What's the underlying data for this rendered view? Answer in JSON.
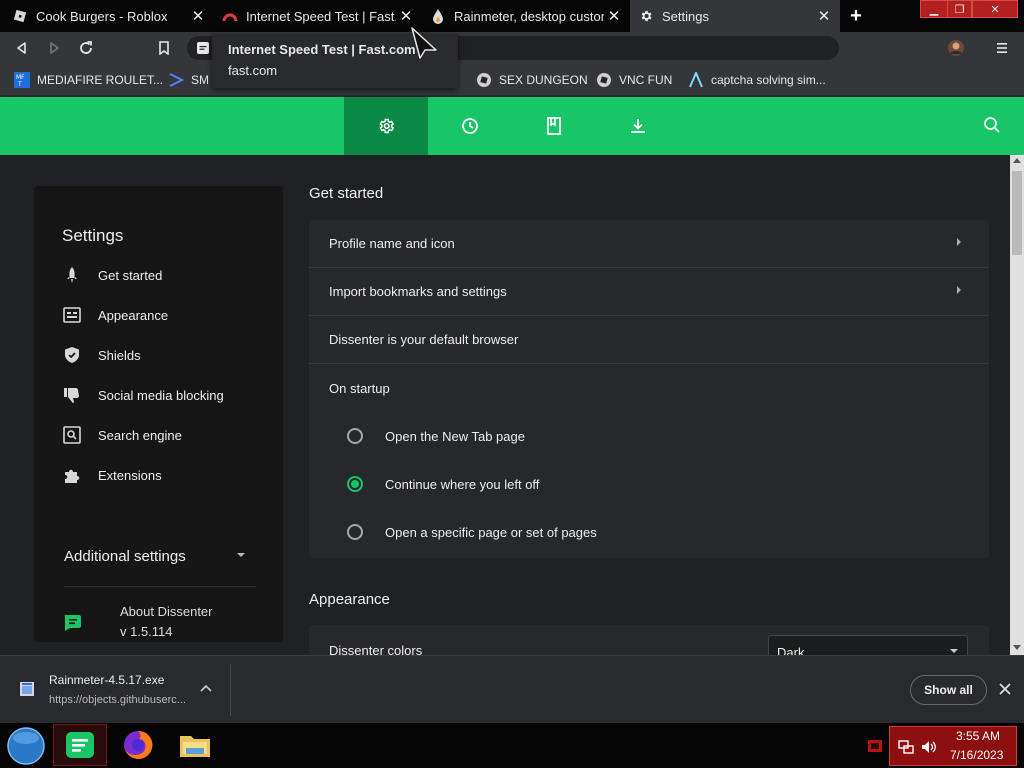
{
  "tabs": [
    {
      "title": "Cook Burgers - Roblox",
      "favicon": "roblox-icon"
    },
    {
      "title": "Internet Speed Test | Fast.com",
      "favicon": "fast-icon"
    },
    {
      "title": "Rainmeter, desktop customiz",
      "favicon": "rainmeter-icon"
    },
    {
      "title": "Settings",
      "favicon": "gear-icon",
      "active": true
    }
  ],
  "tooltip": {
    "title": "Internet Speed Test | Fast.com",
    "url": "fast.com"
  },
  "bookmarks": [
    {
      "label": "MEDIAFIRE ROULET...",
      "icon": "mediafire-icon"
    },
    {
      "label": "SM",
      "icon": "sm-icon"
    },
    {
      "label": "SEX DUNGEON",
      "icon": "roblox-bookmark-icon"
    },
    {
      "label": "VNC FUN",
      "icon": "roblox-bookmark-icon"
    },
    {
      "label": "captcha solving sim...",
      "icon": "captcha-icon"
    }
  ],
  "sidebar": {
    "title": "Settings",
    "items": [
      {
        "label": "Get started",
        "icon": "rocket-icon"
      },
      {
        "label": "Appearance",
        "icon": "appearance-icon"
      },
      {
        "label": "Shields",
        "icon": "shield-icon"
      },
      {
        "label": "Social media blocking",
        "icon": "thumbs-down-icon"
      },
      {
        "label": "Search engine",
        "icon": "search-engine-icon"
      },
      {
        "label": "Extensions",
        "icon": "puzzle-icon"
      }
    ],
    "additional": "Additional settings",
    "about_label": "About Dissenter",
    "version": "v 1.5.114"
  },
  "get_started": {
    "title": "Get started",
    "rows": [
      "Profile name and icon",
      "Import bookmarks and settings",
      "Dissenter is your default browser",
      "On startup"
    ],
    "startup_options": [
      "Open the New Tab page",
      "Continue where you left off",
      "Open a specific page or set of pages"
    ],
    "selected_option": 1
  },
  "appearance": {
    "title": "Appearance",
    "colors_label": "Dissenter colors",
    "colors_value": "Dark"
  },
  "download": {
    "filename": "Rainmeter-4.5.17.exe",
    "url": "https://objects.githubuserc...",
    "show_all": "Show all"
  },
  "clock": {
    "time": "3:55 AM",
    "date": "7/16/2023"
  },
  "colors": {
    "accent": "#18c567",
    "header_active": "#0b8a45",
    "sidebar_bg": "#161617",
    "card_bg": "#27282b"
  }
}
